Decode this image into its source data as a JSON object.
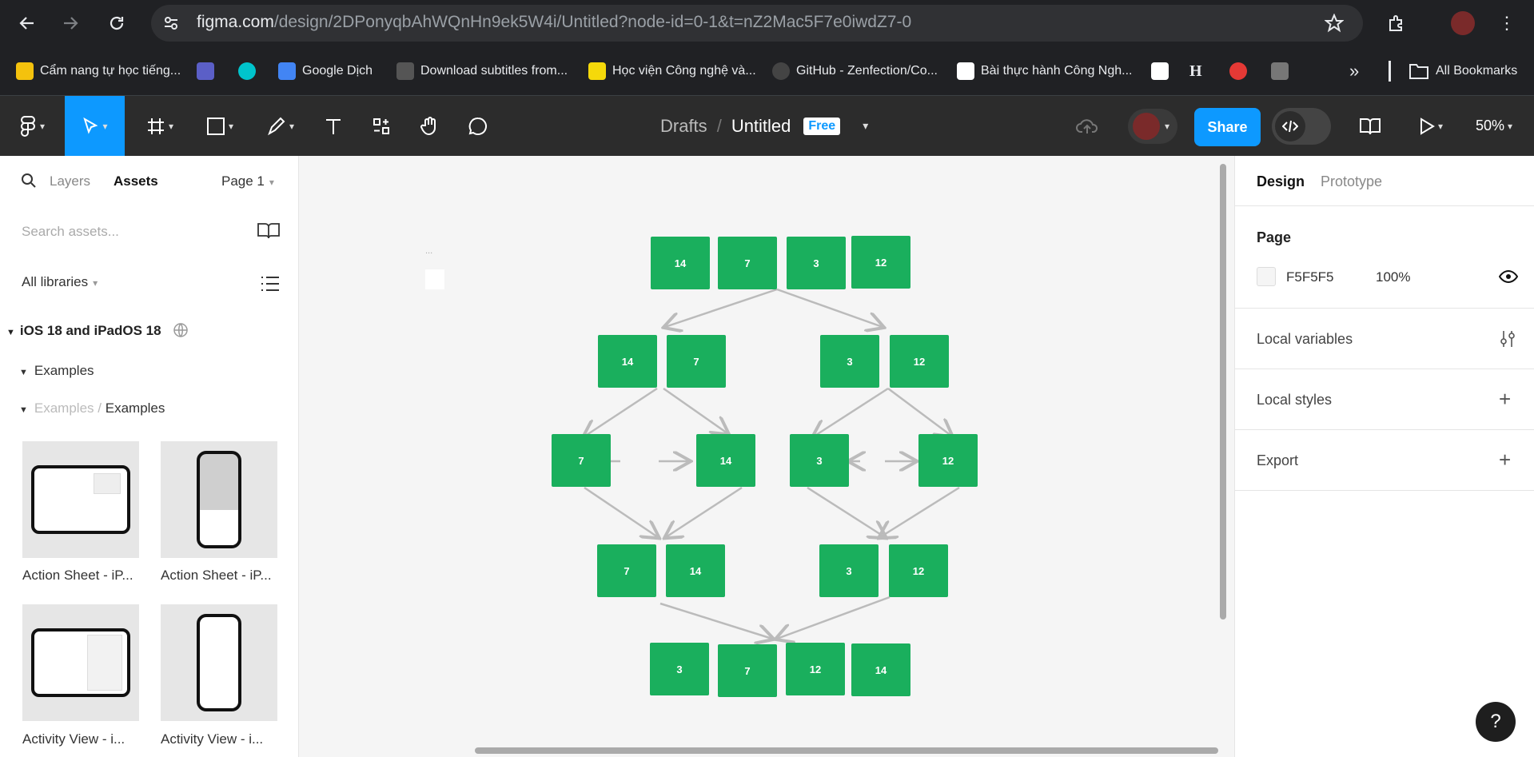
{
  "browser": {
    "url_host": "figma.com",
    "url_path": "/design/2DPonyqbAhWQnHn9ek5W4i/Untitled?node-id=0-1&t=nZ2Mac5F7e0iwdZ7-0",
    "bookmarks": [
      "Cẩm nang tự học tiếng...",
      "Google Dịch",
      "Download subtitles from...",
      "Học viện Công nghệ và...",
      "GitHub - Zenfection/Co...",
      "Bài thực hành Công Ngh..."
    ],
    "all_bookmarks": "All Bookmarks",
    "more": "»"
  },
  "toolbar": {
    "drafts": "Drafts",
    "sep": "/",
    "file_name": "Untitled",
    "plan_badge": "Free",
    "share_label": "Share",
    "zoom": "50%"
  },
  "left_panel": {
    "tab_layers": "Layers",
    "tab_assets": "Assets",
    "page_selector": "Page 1",
    "search_placeholder": "Search assets...",
    "libraries": "All libraries",
    "library_name": "iOS 18 and iPadOS 18",
    "group": "Examples",
    "subgroup_parent": "Examples",
    "subgroup_sep": "/",
    "subgroup_child": "Examples",
    "assets": [
      "Action Sheet - iP...",
      "Action Sheet - iP...",
      "Activity View - i...",
      "Activity View - i..."
    ]
  },
  "canvas": {
    "frame_label": "...",
    "nodes": [
      "14",
      "7",
      "3",
      "12",
      "14",
      "7",
      "3",
      "12",
      "7",
      "14",
      "3",
      "12",
      "7",
      "14",
      "3",
      "12",
      "3",
      "7",
      "12",
      "14"
    ]
  },
  "right_panel": {
    "tab_design": "Design",
    "tab_prototype": "Prototype",
    "page_section": "Page",
    "page_color": "F5F5F5",
    "page_opacity": "100%",
    "local_variables": "Local variables",
    "local_styles": "Local styles",
    "export": "Export",
    "help": "?"
  }
}
